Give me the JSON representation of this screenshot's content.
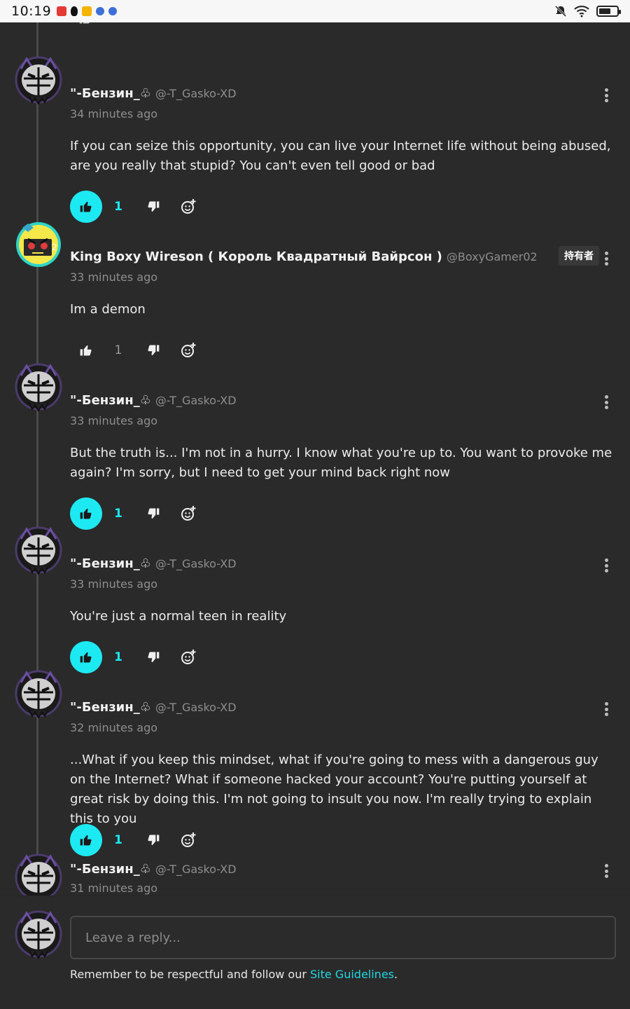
{
  "status_bar": {
    "time": "10:19"
  },
  "colors": {
    "accent": "#1de9f2",
    "background": "#2a2a2a",
    "muted": "#8e8e8e"
  },
  "comments": [
    {
      "user": "\"-Бензин_♧",
      "handle": "@-T_Gasko-XD",
      "time": "34 minutes ago",
      "text": "If you can seize this opportunity, you can live your Internet life without being abused, are you really that stupid? You can't even tell good or bad",
      "likes": "1",
      "liked": true
    },
    {
      "user": "King Boxy Wireson ( Король Квадратный Вайрсон )",
      "handle": "@BoxyGamer02",
      "badge": "持有者",
      "time": "33 minutes ago",
      "text": "Im a demon",
      "likes": "1",
      "liked": false
    },
    {
      "user": "\"-Бензин_♧",
      "handle": "@-T_Gasko-XD",
      "time": "33 minutes ago",
      "text": "But the truth is... I'm not in a hurry. I know what you're up to. You want to provoke me again? I'm sorry, but I need to get your mind back right now",
      "likes": "1",
      "liked": true
    },
    {
      "user": "\"-Бензин_♧",
      "handle": "@-T_Gasko-XD",
      "time": "33 minutes ago",
      "text": "You're just a normal teen in reality",
      "likes": "1",
      "liked": true
    },
    {
      "user": "\"-Бензин_♧",
      "handle": "@-T_Gasko-XD",
      "time": "32 minutes ago",
      "text": "...What if you keep this mindset, what if you're going to mess with a dangerous guy on the Internet? What if someone hacked your account? You're putting yourself at great risk by doing this. I'm not going to insult you now. I'm really trying to explain this to you",
      "likes": "1",
      "liked": true
    },
    {
      "user": "\"-Бензин_♧",
      "handle": "@-T_Gasko-XD",
      "time": "31 minutes ago"
    }
  ],
  "reply": {
    "placeholder": "Leave a reply...",
    "notice_prefix": "Remember to be respectful and follow our ",
    "notice_link": "Site Guidelines",
    "notice_suffix": "."
  }
}
